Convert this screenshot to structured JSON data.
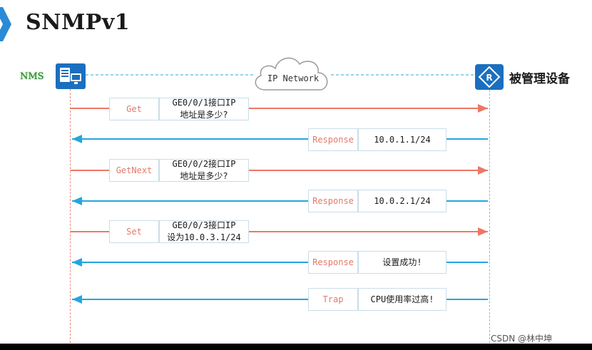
{
  "header": {
    "title": "SNMPv1"
  },
  "nms": {
    "label": "NMS",
    "icon": "nms-computer-icon"
  },
  "network": {
    "label": "IP Network",
    "icon": "cloud-icon"
  },
  "managed_device": {
    "label": "被管理设备",
    "icon": "router-icon"
  },
  "colors": {
    "request_arrow": "#ee7766",
    "response_arrow": "#23a6de",
    "device_blue": "#1b6fbf",
    "op_text": "#e27a6b"
  },
  "messages": [
    {
      "direction": "request",
      "op": "Get",
      "content_line1": "GE0/0/1接口IP",
      "content_line2": "地址是多少?"
    },
    {
      "direction": "response",
      "op": "Response",
      "content_line1": "10.0.1.1/24"
    },
    {
      "direction": "request",
      "op": "GetNext",
      "content_line1": "GE0/0/2接口IP",
      "content_line2": "地址是多少?"
    },
    {
      "direction": "response",
      "op": "Response",
      "content_line1": "10.0.2.1/24"
    },
    {
      "direction": "request",
      "op": "Set",
      "content_line1": "GE0/0/3接口IP",
      "content_line2": "设为10.0.3.1/24"
    },
    {
      "direction": "response",
      "op": "Response",
      "content_line1": "设置成功!"
    },
    {
      "direction": "response",
      "op": "Trap",
      "content_line1": "CPU使用率过高!"
    }
  ],
  "footer": {
    "watermark": "CSDN @林中坤"
  }
}
